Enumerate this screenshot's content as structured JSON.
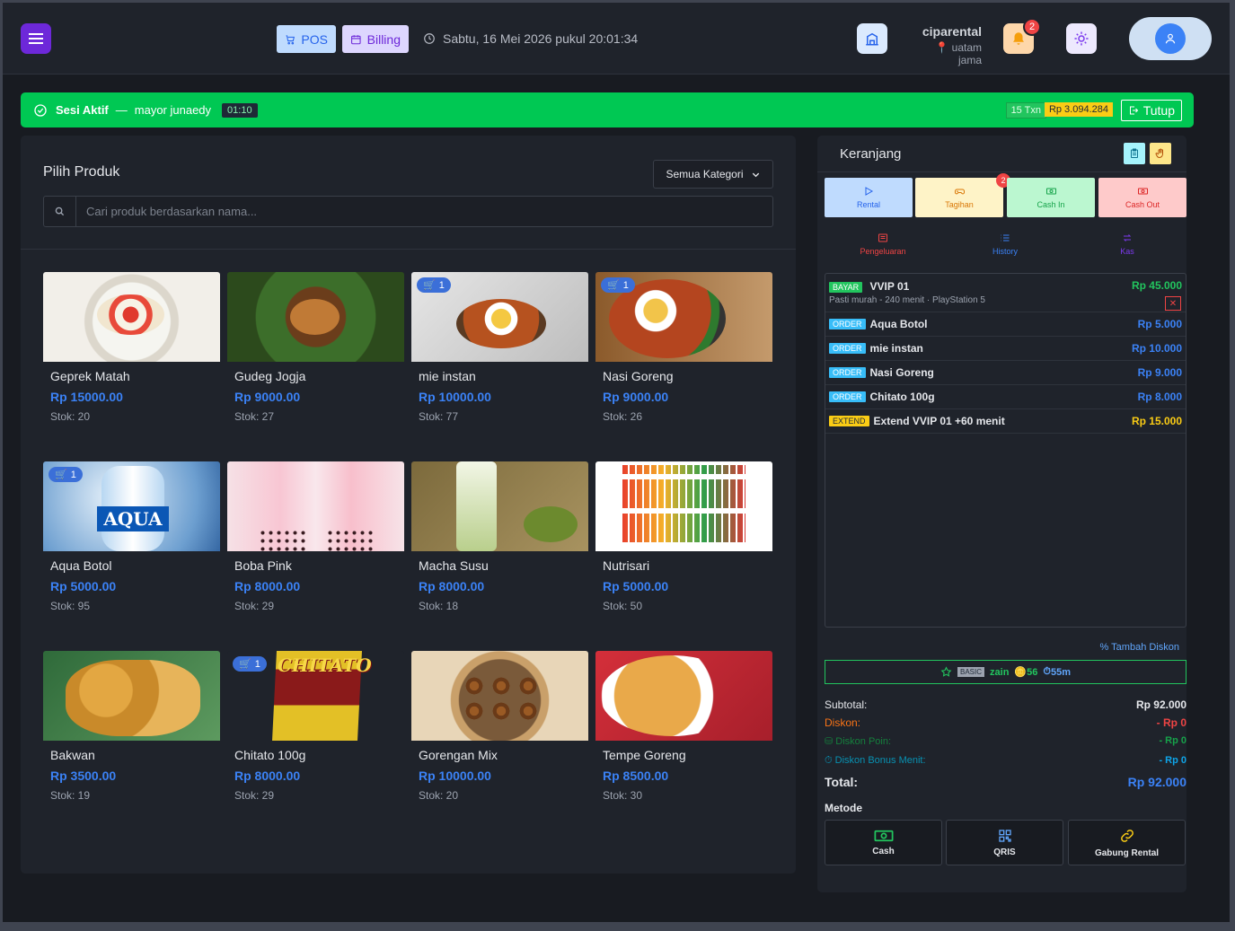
{
  "header": {
    "pos_label": "POS",
    "billing_label": "Billing",
    "datetime": "Sabtu, 16 Mei 2026 pukul 20:01:34",
    "user_name": "ciparental",
    "user_location": "uatam jama",
    "notif_count": "2"
  },
  "session": {
    "label": "Sesi Aktif",
    "separator": "—",
    "operator": "mayor junaedy",
    "timer": "01:10",
    "txn_count": "15 Txn",
    "omzet": "Rp 3.094.284",
    "close_label": "Tutup"
  },
  "products": {
    "title": "Pilih Produk",
    "category_select": "Semua Kategori",
    "search_placeholder": "Cari produk berdasarkan nama...",
    "items": [
      {
        "name": "Geprek Matah",
        "price": "Rp 15000.00",
        "stock": "Stok: 20",
        "in_cart": ""
      },
      {
        "name": "Gudeg Jogja",
        "price": "Rp 9000.00",
        "stock": "Stok: 27",
        "in_cart": ""
      },
      {
        "name": "mie instan",
        "price": "Rp 10000.00",
        "stock": "Stok: 77",
        "in_cart": "1"
      },
      {
        "name": "Nasi Goreng",
        "price": "Rp 9000.00",
        "stock": "Stok: 26",
        "in_cart": "1"
      },
      {
        "name": "Aqua Botol",
        "price": "Rp 5000.00",
        "stock": "Stok: 95",
        "in_cart": "1"
      },
      {
        "name": "Boba Pink",
        "price": "Rp 8000.00",
        "stock": "Stok: 29",
        "in_cart": ""
      },
      {
        "name": "Macha Susu",
        "price": "Rp 8000.00",
        "stock": "Stok: 18",
        "in_cart": ""
      },
      {
        "name": "Nutrisari",
        "price": "Rp 5000.00",
        "stock": "Stok: 50",
        "in_cart": ""
      },
      {
        "name": "Bakwan",
        "price": "Rp 3500.00",
        "stock": "Stok: 19",
        "in_cart": ""
      },
      {
        "name": "Chitato 100g",
        "price": "Rp 8000.00",
        "stock": "Stok: 29",
        "in_cart": "1"
      },
      {
        "name": "Gorengan Mix",
        "price": "Rp 10000.00",
        "stock": "Stok: 20",
        "in_cart": ""
      },
      {
        "name": "Tempe Goreng",
        "price": "Rp 8500.00",
        "stock": "Stok: 30",
        "in_cart": ""
      }
    ]
  },
  "cart": {
    "title": "Keranjang",
    "actions": {
      "rental": "Rental",
      "tagihan": "Tagihan",
      "tagihan_badge": "2",
      "cash_in": "Cash In",
      "cash_out": "Cash Out",
      "pengeluaran": "Pengeluaran",
      "history": "History",
      "kas": "Kas"
    },
    "rental_item": {
      "tag": "BAYAR",
      "name": "VVIP 01",
      "detail": "Pasti murah - 240 menit · PlayStation 5",
      "price": "Rp 45.000"
    },
    "orders": [
      {
        "tag": "ORDER",
        "name": "Aqua Botol",
        "price": "Rp 5.000"
      },
      {
        "tag": "ORDER",
        "name": "mie instan",
        "price": "Rp 10.000"
      },
      {
        "tag": "ORDER",
        "name": "Nasi Goreng",
        "price": "Rp 9.000"
      },
      {
        "tag": "ORDER",
        "name": "Chitato 100g",
        "price": "Rp 8.000"
      }
    ],
    "extend_item": {
      "tag": "EXTEND",
      "name": "Extend VVIP 01 +60 menit",
      "price": "Rp 15.000"
    },
    "add_discount": "Tambah Diskon",
    "member": {
      "tier": "BASIC",
      "name": "zain",
      "points": "56",
      "minutes": "55m"
    },
    "summary": {
      "subtotal_label": "Subtotal:",
      "subtotal": "Rp 92.000",
      "diskon_label": "Diskon:",
      "diskon": "- Rp 0",
      "diskon_poin_label": "Diskon Poin:",
      "diskon_poin": "- Rp 0",
      "diskon_bonus_label": "Diskon Bonus Menit:",
      "diskon_bonus": "- Rp 0",
      "total_label": "Total:",
      "total": "Rp 92.000"
    },
    "method_label": "Metode",
    "methods": {
      "cash": "Cash",
      "qris": "QRIS",
      "gabung": "Gabung Rental"
    }
  },
  "colors": {
    "accent": "#3b82f6",
    "session_bg": "#00c853",
    "panel_bg": "#1f232b",
    "page_bg": "#181b21"
  }
}
